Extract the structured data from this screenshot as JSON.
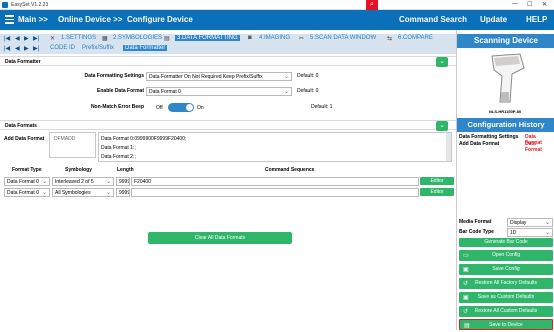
{
  "window": {
    "title": "EasySet V1.2.23",
    "minimize": "—",
    "maximize": "☐",
    "close": "✕"
  },
  "menu": {
    "main": "Main >>",
    "online_device": "Online Device >>",
    "configure_device": "Configure Device",
    "command_search": "Command Search",
    "update": "Update",
    "help": "HELP"
  },
  "tabs": [
    {
      "label": "1.SETTINGS"
    },
    {
      "label": "2.SYMBOLOGIES"
    },
    {
      "label": "3.DATA FORMATTING"
    },
    {
      "label": "4.IMAGING"
    },
    {
      "label": "5.SCAN DATA WINDOW"
    },
    {
      "label": "6.COMPARE"
    }
  ],
  "subtabs": [
    {
      "label": "CODE ID"
    },
    {
      "label": "Prefix/Suffix"
    },
    {
      "label": "Data Formatter"
    }
  ],
  "formatter": {
    "section_title": "Data Formatter",
    "settings_label": "Data Formatting Settings",
    "settings_value": "Data Formatter On Not Required Keep Prefix/Suffix",
    "settings_default": "Default: 0",
    "enable_label": "Enable Data Format",
    "enable_value": "Data Format 0",
    "enable_default": "Default: 0",
    "beep_label": "Non-Match Error Beep",
    "beep_off": "Off",
    "beep_on": "On",
    "beep_default": "Default: 1"
  },
  "formats": {
    "section_title": "Data Formats",
    "add_label": "Add Data Format",
    "add_placeholder": "DFMADD",
    "lines": [
      "Data Format 0:0999900F9999F20400;",
      "Data Format 1:;",
      "Data Format 2:;"
    ],
    "headers": {
      "format_type": "Format Type",
      "symbology": "Symbology",
      "length": "Length",
      "command_sequence": "Command Sequence"
    },
    "rows": [
      {
        "format_type": "Data Format 0",
        "symbology": "Interleaved 2 of 5",
        "length": "9999",
        "command": "F20400",
        "editor": "Editor"
      },
      {
        "format_type": "Data Format 0",
        "symbology": "All Symbologies",
        "length": "9999",
        "command": "",
        "editor": "Editor"
      }
    ],
    "clear_all": "Clear All Data Formats"
  },
  "right": {
    "scanning_device": "Scanning Device",
    "model": "NLS-HR1150P-80",
    "config_history": "Configuration History",
    "history": [
      {
        "key": "Data Formatting Settings",
        "value": "Data Format"
      },
      {
        "key": "Add Data Format",
        "value": "Data Format"
      }
    ],
    "media_format_label": "Media Format",
    "media_format_value": "Display",
    "bar_code_type_label": "Bar Code Type",
    "bar_code_type_value": "1D",
    "generate": "Generate Bar Code",
    "buttons": [
      "Open Config",
      "Save Config",
      "Restore All Factory Defaults",
      "Save as Custom Defaults",
      "Restore All Custom Defaults",
      "Save to Device"
    ]
  },
  "colors": {
    "brand_blue": "#0a70b9",
    "accent_green": "#2fb66a",
    "history_red": "#e02020",
    "highlight_red": "#d92020"
  }
}
